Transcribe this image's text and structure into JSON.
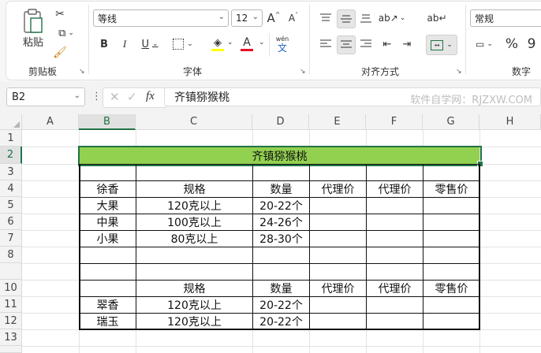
{
  "ribbon": {
    "clipboard": {
      "paste_label": "粘贴",
      "group_label": "剪贴板"
    },
    "font": {
      "name": "等线",
      "size": "12",
      "bold": "B",
      "italic": "I",
      "underline": "U",
      "phonetic_top": "wén",
      "phonetic_bottom": "文",
      "grow": "A",
      "shrink": "A",
      "group_label": "字体"
    },
    "alignment": {
      "group_label": "对齐方式"
    },
    "number": {
      "format": "常规",
      "percent": "%",
      "group_label": "数字"
    },
    "colors": {
      "accent": "#217346",
      "font_color_bar": "#e81123",
      "fill_color_bar": "#ffff00"
    }
  },
  "formula_bar": {
    "name_box": "B2",
    "fx": "fx",
    "content": "齐镇猕猴桃",
    "watermark": "软件自学网：RJZXW.COM"
  },
  "sheet": {
    "columns": [
      "A",
      "B",
      "C",
      "D",
      "E",
      "F",
      "G",
      "H"
    ],
    "selected_column": "B",
    "rows": [
      "1",
      "2",
      "3",
      "4",
      "5",
      "6",
      "7",
      "8",
      "10",
      "11",
      "12",
      "13",
      "14"
    ],
    "selected_row": "2",
    "title": "齐镇猕猴桃",
    "title_fill": "#92d050",
    "header1": {
      "b": "徐香",
      "c": "规格",
      "d": "数量",
      "e": "代理价",
      "f": "代理价",
      "g": "零售价"
    },
    "rows1": [
      {
        "b": "大果",
        "c": "120克以上",
        "d": "20-22个"
      },
      {
        "b": "中果",
        "c": "100克以上",
        "d": "24-26个"
      },
      {
        "b": "小果",
        "c": "80克以上",
        "d": "28-30个"
      }
    ],
    "header2": {
      "c": "规格",
      "d": "数量",
      "e": "代理价",
      "f": "代理价",
      "g": "零售价"
    },
    "rows2": [
      {
        "b": "翠香",
        "c": "120克以上",
        "d": "20-22个"
      },
      {
        "b": "瑞玉",
        "c": "120克以上",
        "d": "20-22个"
      }
    ]
  }
}
